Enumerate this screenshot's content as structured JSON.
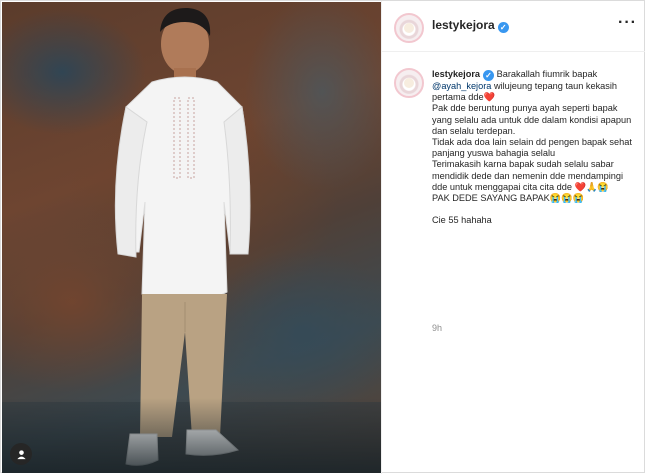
{
  "post": {
    "username": "lestykejora",
    "more_icon": "more-horizontal-icon",
    "caption": {
      "username": "lestykejora",
      "intro": "Barakallah fiumrik bapak ",
      "mention": "@ayah_kejora",
      "line1_rest": " wilujeung tepang taun kekasih pertama dde",
      "heart": "❤️",
      "body1": "Pak dde beruntung punya ayah seperti bapak yang selalu ada untuk dde dalam kondisi apapun dan selalu terdepan.\nTidak ada doa lain selain dd pengen bapak sehat panjang yuswa bahagia selalu\nTerimakasih karna bapak sudah selalu sabar mendidik dede dan nemenin dde mendampingi dde untuk menggapai cita cita dde ",
      "emoji1": "❤️🙏😭",
      "body2": "\nPAK DEDE SAYANG BAPAK",
      "emoji2": "😭😭😭",
      "body3": "\n\nCie 55 hahaha"
    },
    "timestamp": "9h"
  },
  "colors": {
    "verified": "#3897f0",
    "mention": "#00376b",
    "muted": "#8e8e8e"
  }
}
